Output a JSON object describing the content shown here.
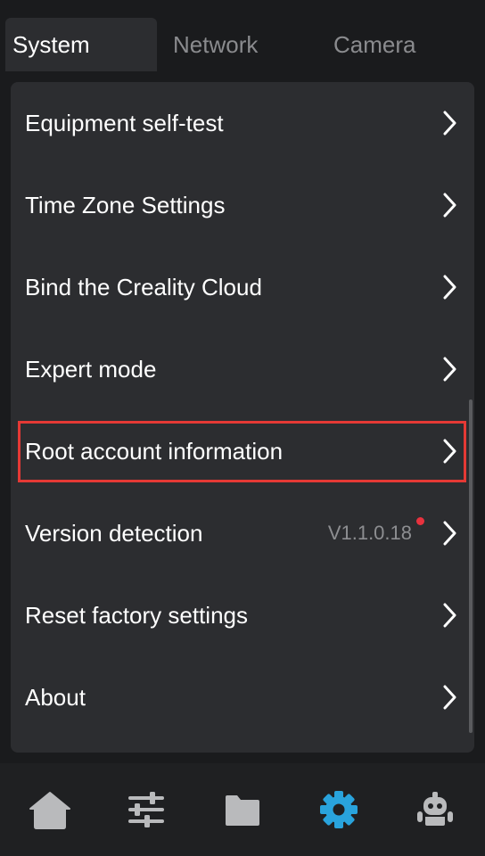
{
  "tabs": [
    {
      "label": "System",
      "active": true
    },
    {
      "label": "Network",
      "active": false
    },
    {
      "label": "Camera",
      "active": false
    }
  ],
  "menu": {
    "items": [
      {
        "label": "Equipment self-test"
      },
      {
        "label": "Time Zone Settings"
      },
      {
        "label": "Bind the Creality Cloud"
      },
      {
        "label": "Expert mode"
      },
      {
        "label": "Root account information",
        "highlighted": true
      },
      {
        "label": "Version detection",
        "value": "V1.1.0.18",
        "update_indicator": true
      },
      {
        "label": "Reset factory settings"
      },
      {
        "label": "About"
      }
    ]
  },
  "bottom_nav": [
    {
      "icon": "home-icon",
      "active": false
    },
    {
      "icon": "sliders-icon",
      "active": false
    },
    {
      "icon": "folder-icon",
      "active": false
    },
    {
      "icon": "gear-icon",
      "active": true
    },
    {
      "icon": "robot-icon",
      "active": false
    }
  ],
  "colors": {
    "background": "#1a1b1d",
    "panel": "#2c2d30",
    "active_icon": "#29a3dc",
    "inactive_icon": "#b9babc",
    "highlight_border": "#e53935",
    "update_dot": "#e8323e"
  }
}
